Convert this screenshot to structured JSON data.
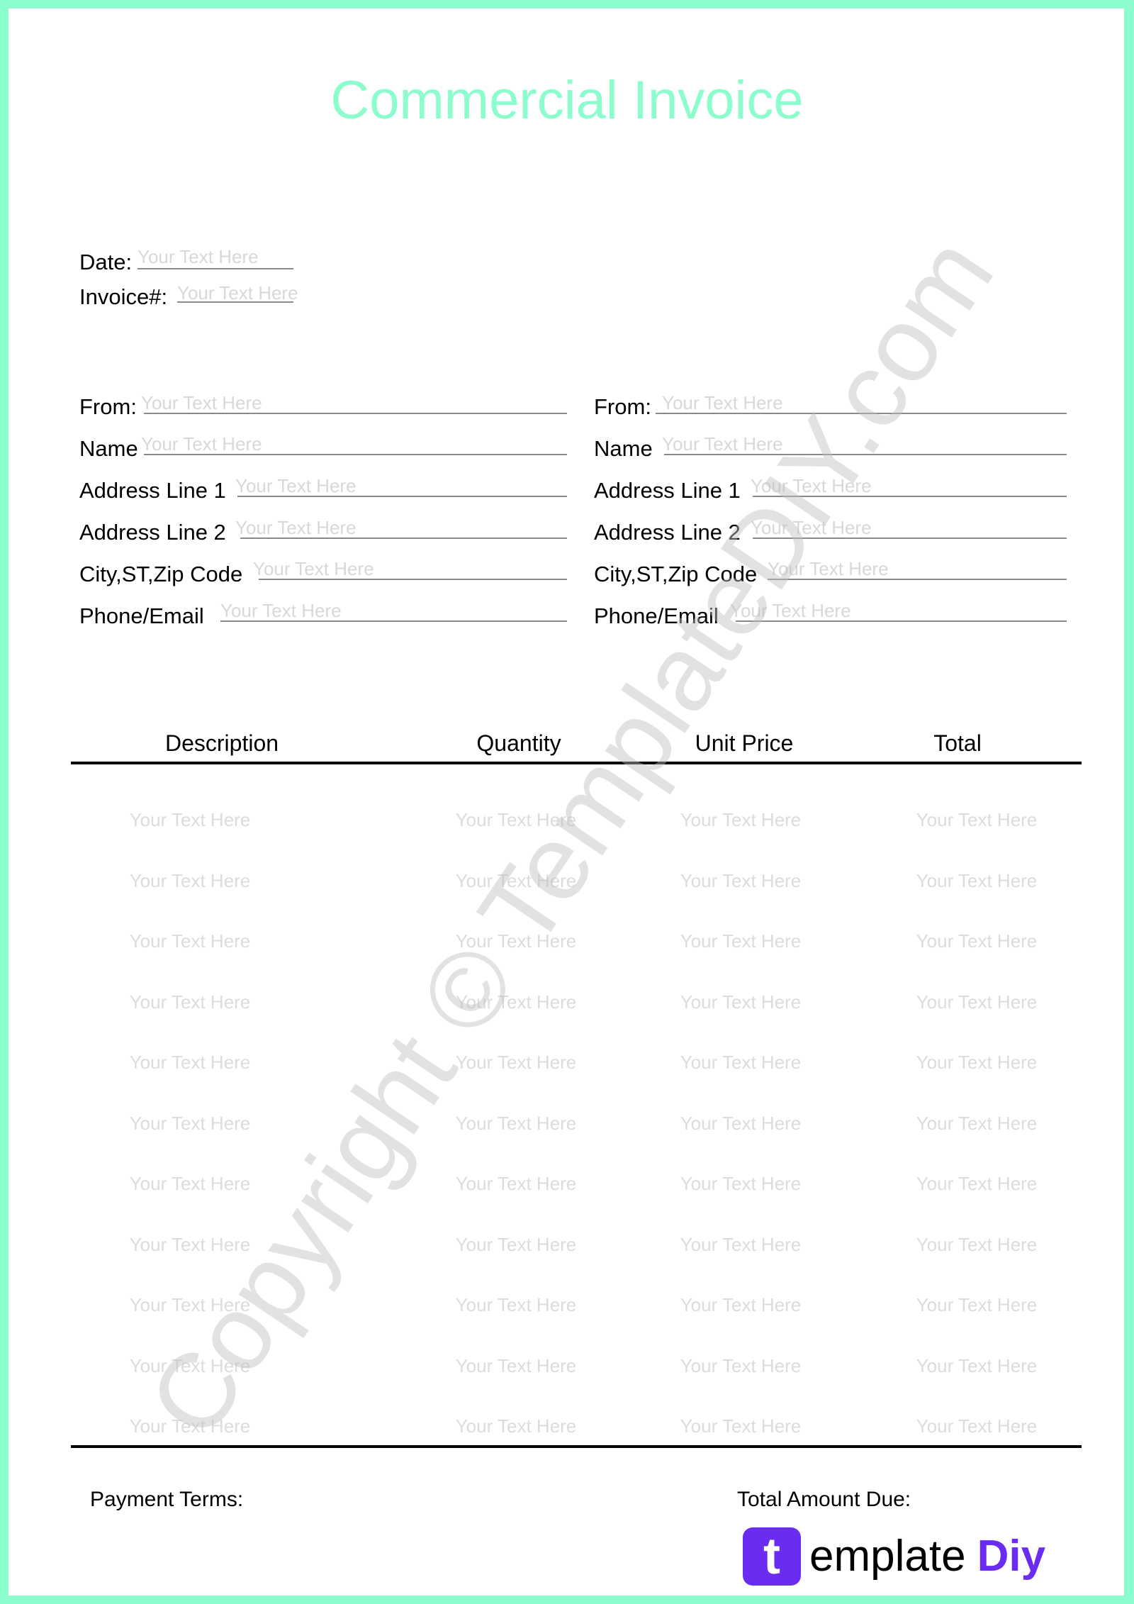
{
  "document": {
    "title": "Commercial Invoice",
    "accent_color": "#8cfdcc",
    "brand_color": "#6a2cf0"
  },
  "meta_fields": [
    {
      "label": "Date:",
      "placeholder": "Your Text Here"
    },
    {
      "label": "Invoice#:",
      "placeholder": "Your Text Here"
    }
  ],
  "left_party": [
    {
      "label": "From:",
      "placeholder": "Your Text Here"
    },
    {
      "label": "Name",
      "placeholder": "Your Text Here"
    },
    {
      "label": "Address Line 1",
      "placeholder": "Your Text Here"
    },
    {
      "label": "Address Line 2",
      "placeholder": "Your Text Here"
    },
    {
      "label": "City,ST,Zip Code",
      "placeholder": "Your Text Here"
    },
    {
      "label": "Phone/Email",
      "placeholder": "Your Text Here"
    }
  ],
  "right_party": [
    {
      "label": "From:",
      "placeholder": "Your Text Here"
    },
    {
      "label": "Name",
      "placeholder": "Your Text Here"
    },
    {
      "label": "Address Line 1",
      "placeholder": "Your Text Here"
    },
    {
      "label": "Address Line 2",
      "placeholder": "Your Text Here"
    },
    {
      "label": "City,ST,Zip Code",
      "placeholder": "Your Text Here"
    },
    {
      "label": "Phone/Email",
      "placeholder": "Your Text Here"
    }
  ],
  "table": {
    "columns": [
      "Description",
      "Quantity",
      "Unit Price",
      "Total"
    ],
    "rows": [
      [
        "Your Text Here",
        "Your Text Here",
        "Your Text Here",
        "Your Text Here"
      ],
      [
        "Your Text Here",
        "Your Text Here",
        "Your Text Here",
        "Your Text Here"
      ],
      [
        "Your Text Here",
        "Your Text Here",
        "Your Text Here",
        "Your Text Here"
      ],
      [
        "Your Text Here",
        "Your Text Here",
        "Your Text Here",
        "Your Text Here"
      ],
      [
        "Your Text Here",
        "Your Text Here",
        "Your Text Here",
        "Your Text Here"
      ],
      [
        "Your Text Here",
        "Your Text Here",
        "Your Text Here",
        "Your Text Here"
      ],
      [
        "Your Text Here",
        "Your Text Here",
        "Your Text Here",
        "Your Text Here"
      ],
      [
        "Your Text Here",
        "Your Text Here",
        "Your Text Here",
        "Your Text Here"
      ],
      [
        "Your Text Here",
        "Your Text Here",
        "Your Text Here",
        "Your Text Here"
      ],
      [
        "Your Text Here",
        "Your Text Here",
        "Your Text Here",
        "Your Text Here"
      ],
      [
        "Your Text Here",
        "Your Text Here",
        "Your Text Here",
        "Your Text Here"
      ]
    ]
  },
  "footer": {
    "payment_terms_label": "Payment Terms:",
    "total_due_label": "Total Amount Due:"
  },
  "watermark": "Copyright © TemplateDIY.com",
  "logo": {
    "icon_letter": "t",
    "word": "emplate",
    "accent_word": "Diy"
  }
}
